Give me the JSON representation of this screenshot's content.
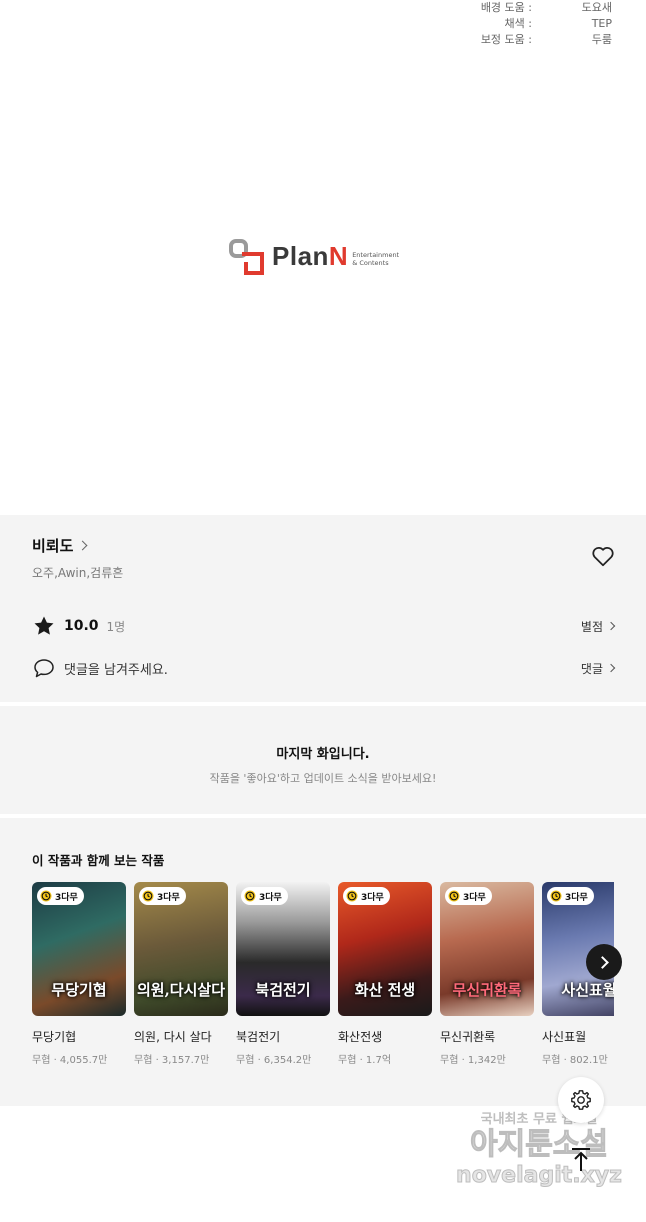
{
  "credits": [
    {
      "role": "배경 도움 :",
      "name": "도요새"
    },
    {
      "role": "채색 :",
      "name": "TEP"
    },
    {
      "role": "보정 도움 :",
      "name": "두룸"
    }
  ],
  "logo": {
    "text_main": "Plan",
    "text_n": "N",
    "sub1": "Entertainment",
    "sub2": "& Contents"
  },
  "work": {
    "title": "비뢰도",
    "authors": "오주,Awin,검류흔",
    "score": "10.0",
    "rating_count": "1명",
    "rate_link": "별점",
    "comment_placeholder": "댓글을 남겨주세요.",
    "comment_link": "댓글"
  },
  "last_episode": {
    "title": "마지막 화입니다.",
    "subtitle": "작품을 '좋아요'하고 업데이트 소식을 받아보세요!"
  },
  "recommendations": {
    "heading": "이 작품과 함께 보는 작품",
    "items": [
      {
        "badge": "3다무",
        "name": "무당기협",
        "meta": "무협 · 4,055.7만",
        "cover_text": "무당기협"
      },
      {
        "badge": "3다무",
        "name": "의원, 다시 살다",
        "meta": "무협 · 3,157.7만",
        "cover_text": "의원,다시살다"
      },
      {
        "badge": "3다무",
        "name": "북검전기",
        "meta": "무협 · 6,354.2만",
        "cover_text": "북검전기"
      },
      {
        "badge": "3다무",
        "name": "화산전생",
        "meta": "무협 · 1.7억",
        "cover_text": "화산 전생"
      },
      {
        "badge": "3다무",
        "name": "무신귀환록",
        "meta": "무협 · 1,342만",
        "cover_text": "무신귀환록"
      },
      {
        "badge": "3다무",
        "name": "사신표월",
        "meta": "무협 · 802.1만",
        "cover_text": "사신표월"
      }
    ]
  },
  "watermark": {
    "line1": "국내최초 무료 웹소설",
    "line2": "아지툰소설",
    "line3": "novelagit.xyz"
  },
  "colors": {
    "section_bg": "#f4f4f4",
    "accent_red": "#e03a2e"
  },
  "icons": [
    "heart-icon",
    "star-icon",
    "speech-bubble-icon",
    "clock-icon",
    "chevron-right-icon",
    "gear-icon",
    "arrow-up-icon"
  ]
}
